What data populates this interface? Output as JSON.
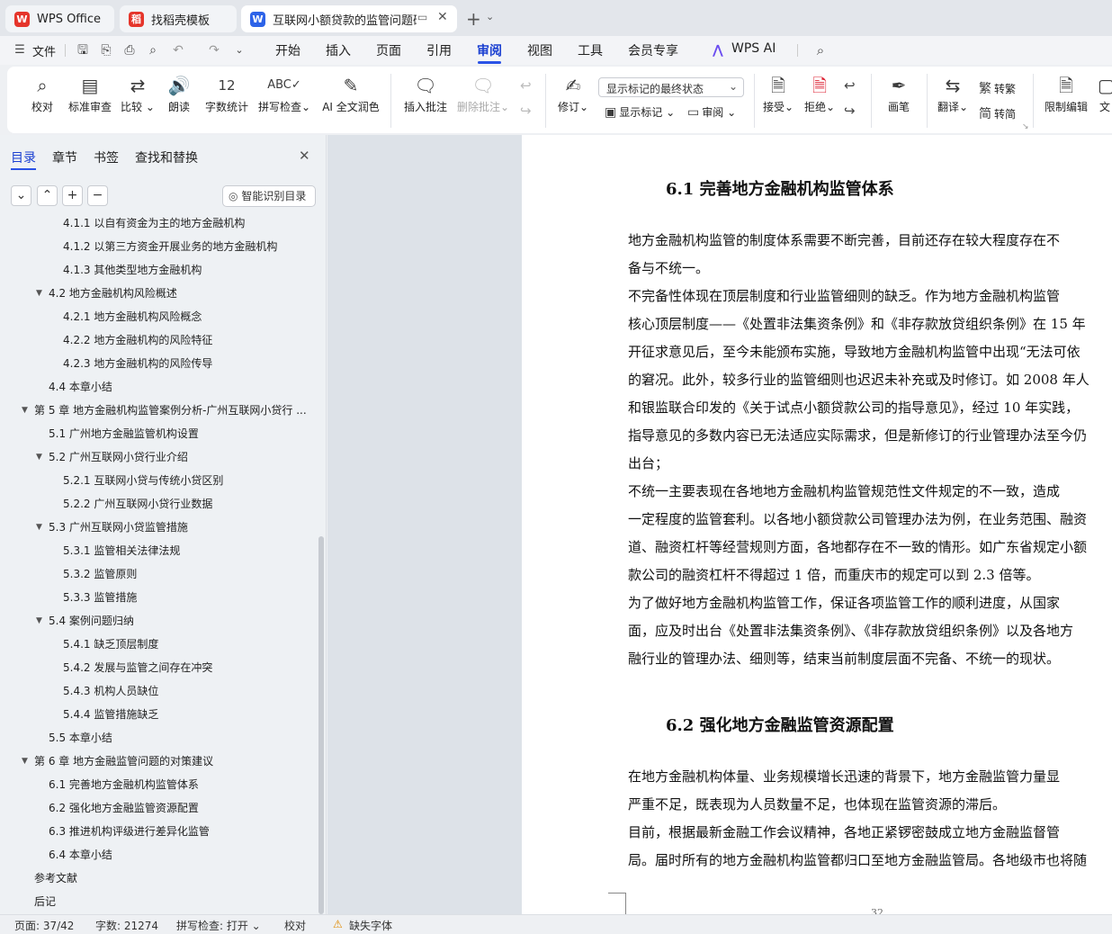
{
  "tabs": {
    "wps_office": "WPS Office",
    "daoke": "找稻壳模板",
    "document": "互联网小额贷款的监管问题研究"
  },
  "menu": {
    "file": "文件",
    "items": [
      "开始",
      "插入",
      "页面",
      "引用",
      "审阅",
      "视图",
      "工具",
      "会员专享"
    ],
    "active": "审阅",
    "wps_ai": "WPS AI"
  },
  "ribbon": {
    "proofread": "校对",
    "standard_review": "标准审查",
    "compare": "比较",
    "read_aloud": "朗读",
    "word_count": "字数统计",
    "spell_check": "拼写检查",
    "ai_polish": "AI 全文润色",
    "insert_comment": "插入批注",
    "delete_comment": "删除批注",
    "track_changes": "修订",
    "markup_select": "显示标记的最终状态",
    "show_markup": "显示标记",
    "review": "审阅",
    "accept": "接受",
    "reject": "拒绝",
    "pen": "画笔",
    "translate": "翻译",
    "to_traditional": "转繁",
    "to_simplified": "转简",
    "restrict_edit": "限制编辑",
    "doc_cut": "文"
  },
  "sidebar": {
    "tabs": [
      "目录",
      "章节",
      "书签",
      "查找和替换"
    ],
    "smart_toc": "智能识别目录",
    "toc": [
      {
        "label": "4.1.1  以自有资金为主的地方金融机构",
        "level": 3
      },
      {
        "label": "4.1.2  以第三方资金开展业务的地方金融机构",
        "level": 3
      },
      {
        "label": "4.1.3  其他类型地方金融机构",
        "level": 3
      },
      {
        "label": "4.2  地方金融机构风险概述",
        "level": 2,
        "expanded": true
      },
      {
        "label": "4.2.1  地方金融机构风险概念",
        "level": 3
      },
      {
        "label": "4.2.2  地方金融机构的风险特征",
        "level": 3
      },
      {
        "label": "4.2.3  地方金融机构的风险传导",
        "level": 3
      },
      {
        "label": "4.4  本章小结",
        "level": 2
      },
      {
        "label": "第 5 章  地方金融机构监管案例分析-广州互联网小贷行 ...",
        "level": 1,
        "expanded": true
      },
      {
        "label": "5.1  广州地方金融监管机构设置",
        "level": 2
      },
      {
        "label": "5.2  广州互联网小贷行业介绍",
        "level": 2,
        "expanded": true
      },
      {
        "label": "5.2.1  互联网小贷与传统小贷区别",
        "level": 3
      },
      {
        "label": "5.2.2  广州互联网小贷行业数据",
        "level": 3
      },
      {
        "label": "5.3  广州互联网小贷监管措施",
        "level": 2,
        "expanded": true
      },
      {
        "label": "5.3.1  监管相关法律法规",
        "level": 3
      },
      {
        "label": "5.3.2  监管原则",
        "level": 3
      },
      {
        "label": "5.3.3  监管措施",
        "level": 3
      },
      {
        "label": "5.4  案例问题归纳",
        "level": 2,
        "expanded": true
      },
      {
        "label": "5.4.1  缺乏顶层制度",
        "level": 3
      },
      {
        "label": "5.4.2  发展与监管之间存在冲突",
        "level": 3
      },
      {
        "label": "5.4.3  机构人员缺位",
        "level": 3
      },
      {
        "label": "5.4.4  监管措施缺乏",
        "level": 3
      },
      {
        "label": "5.5  本章小结",
        "level": 2
      },
      {
        "label": "第 6 章  地方金融监管问题的对策建议",
        "level": 1,
        "expanded": true
      },
      {
        "label": "6.1  完善地方金融机构监管体系",
        "level": 2
      },
      {
        "label": "6.2  强化地方金融监管资源配置",
        "level": 2
      },
      {
        "label": "6.3  推进机构评级进行差异化监管",
        "level": 2
      },
      {
        "label": "6.4  本章小结",
        "level": 2
      },
      {
        "label": "参考文献",
        "level": 1
      },
      {
        "label": "后记",
        "level": 1
      }
    ]
  },
  "document": {
    "heading1": "6.1  完善地方金融机构监管体系",
    "lines1": [
      "    地方金融机构监管的制度体系需要不断完善，目前还存在较大程度存在不",
      "备与不统一。",
      "    不完备性体现在顶层制度和行业监管细则的缺乏。作为地方金融机构监管",
      "核心顶层制度——《处置非法集资条例》和《非存款放贷组织条例》在 15 年",
      "开征求意见后，至今未能颁布实施，导致地方金融机构监管中出现“无法可依",
      "的窘况。此外，较多行业的监管细则也迟迟未补充或及时修订。如 2008 年人",
      "和银监联合印发的《关于试点小额贷款公司的指导意见》，经过 10 年实践，",
      "指导意见的多数内容已无法适应实际需求，但是新修订的行业管理办法至今仍",
      "出台；",
      "    不统一主要表现在各地地方金融机构监管规范性文件规定的不一致，造成",
      "一定程度的监管套利。以各地小额贷款公司管理办法为例，在业务范围、融资",
      "道、融资杠杆等经营规则方面，各地都存在不一致的情形。如广东省规定小额",
      "款公司的融资杠杆不得超过 1 倍，而重庆市的规定可以到 2.3 倍等。",
      "    为了做好地方金融机构监管工作，保证各项监管工作的顺利进度，从国家",
      "面，应及时出台《处置非法集资条例》、《非存款放贷组织条例》以及各地方",
      "融行业的管理办法、细则等，结束当前制度层面不完备、不统一的现状。"
    ],
    "heading2": "6.2  强化地方金融监管资源配置",
    "lines2": [
      "    在地方金融机构体量、业务规模增长迅速的背景下，地方金融监管力量显",
      "严重不足，既表现为人员数量不足，也体现在监管资源的滞后。",
      "    目前，根据最新金融工作会议精神，各地正紧锣密鼓成立地方金融监督管",
      "局。届时所有的地方金融机构监管都归口至地方金融监管局。各地级市也将随"
    ],
    "page_number": "32"
  },
  "status": {
    "page": "页面: 37/42",
    "words": "字数: 21274",
    "spell": "拼写检查: 打开",
    "proof": "校对",
    "missing_font": "缺失字体"
  },
  "colors": {
    "accent": "#2a52e6",
    "active_text": "#1a3fd1",
    "wps_red": "#e5352b",
    "doc_blue": "#2d63e8"
  }
}
